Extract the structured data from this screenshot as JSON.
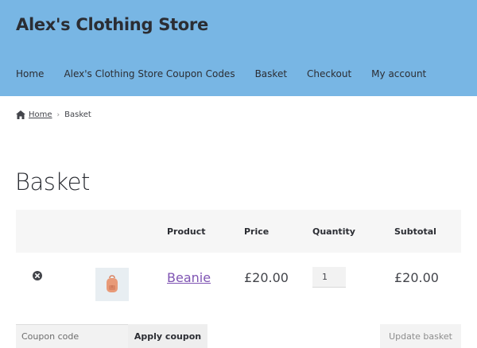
{
  "header": {
    "site_title": "Alex's Clothing Store",
    "nav": [
      "Home",
      "Alex's Clothing Store Coupon Codes",
      "Basket",
      "Checkout",
      "My account"
    ]
  },
  "breadcrumb": {
    "home": "Home",
    "separator": "›",
    "current": "Basket"
  },
  "page_title": "Basket",
  "cart": {
    "columns": {
      "product": "Product",
      "price": "Price",
      "quantity": "Quantity",
      "subtotal": "Subtotal"
    },
    "items": [
      {
        "name": "Beanie",
        "price": "£20.00",
        "quantity": "1",
        "subtotal": "£20.00",
        "thumbnail_icon": "backpack-icon"
      }
    ]
  },
  "actions": {
    "coupon_placeholder": "Coupon code",
    "apply_label": "Apply coupon",
    "update_label": "Update basket"
  },
  "colors": {
    "header_bg": "#78b6e4",
    "link": "#7f54b3",
    "text": "#43454b"
  }
}
